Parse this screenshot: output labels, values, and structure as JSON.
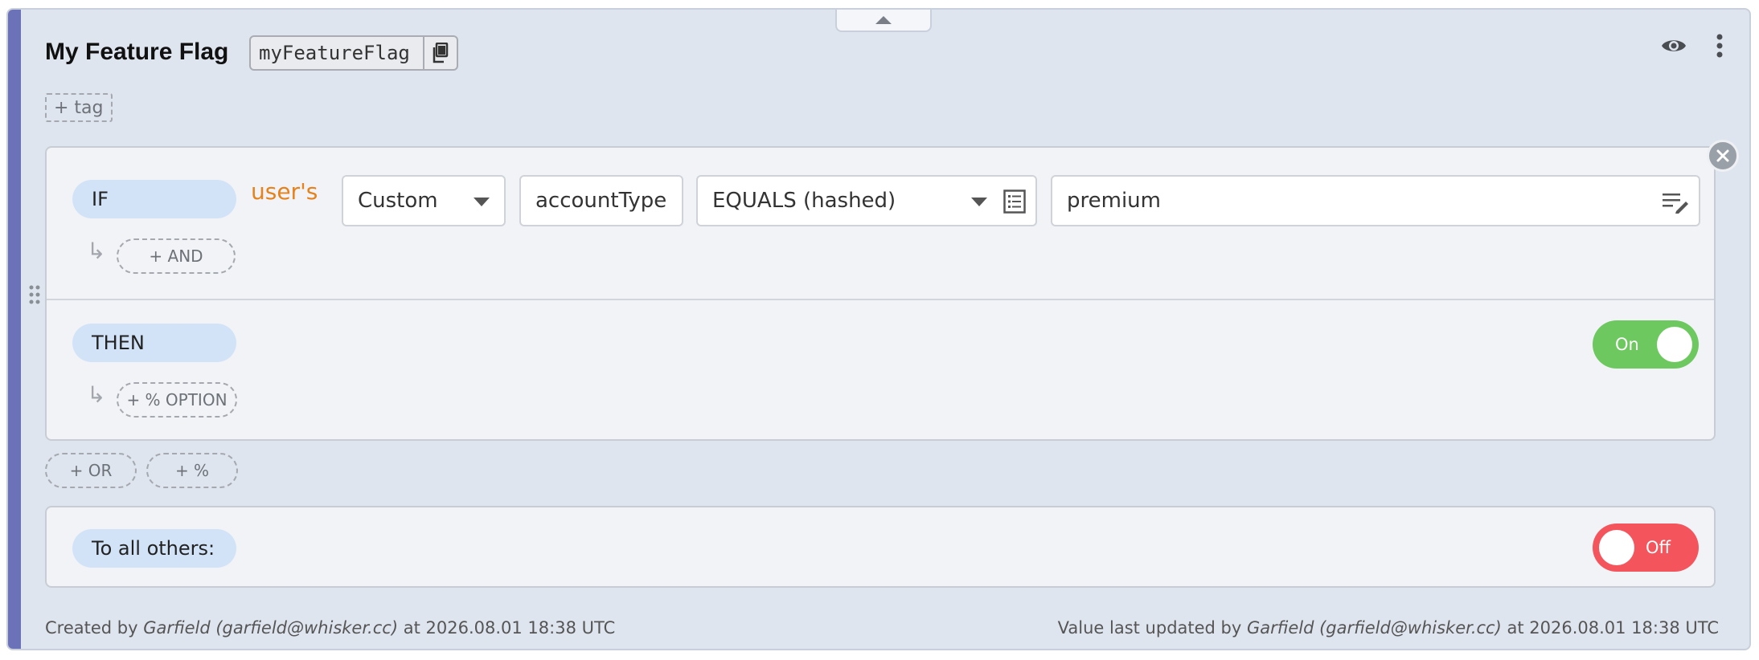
{
  "flag": {
    "title": "My Feature Flag",
    "key": "myFeatureFlag",
    "tag_button": "+ tag"
  },
  "rule": {
    "if_label": "IF",
    "users_label": "user's",
    "attribute_type": "Custom",
    "attribute_name": "accountType",
    "comparator": "EQUALS (hashed)",
    "comparison_value": "premium",
    "and_button": "+ AND",
    "then_label": "THEN",
    "option_button": "+ % OPTION",
    "then_toggle": "On"
  },
  "actions": {
    "or_button": "+ OR",
    "percent_button": "+ %"
  },
  "others": {
    "label": "To all others:",
    "toggle": "Off"
  },
  "footer": {
    "created_prefix": "Created by",
    "created_by": "Garfield (garfield@whisker.cc)",
    "created_at": "at 2026.08.01 18:38 UTC",
    "updated_prefix": "Value last updated by",
    "updated_by": "Garfield (garfield@whisker.cc)",
    "updated_at": "at 2026.08.01 18:38 UTC"
  },
  "colors": {
    "accent": "#6b72b8",
    "on_toggle": "#6cc85f",
    "off_toggle": "#f4545c",
    "users_label": "#e5821c",
    "pill": "#d2e3f8"
  }
}
